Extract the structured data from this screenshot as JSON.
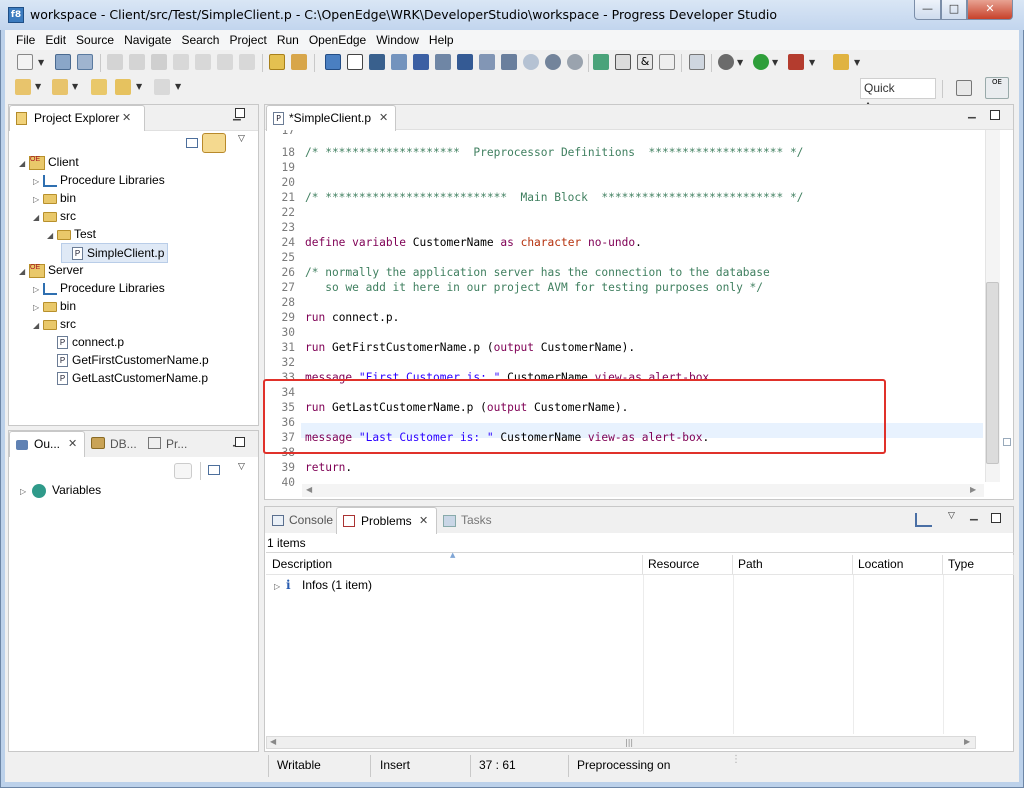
{
  "window": {
    "title": "workspace - Client/src/Test/SimpleClient.p - C:\\OpenEdge\\WRK\\DeveloperStudio\\workspace - Progress Developer Studio",
    "controls": {
      "minimize": "—",
      "maximize": "□",
      "close": "✕"
    }
  },
  "menubar": [
    "File",
    "Edit",
    "Source",
    "Navigate",
    "Search",
    "Project",
    "Run",
    "OpenEdge",
    "Window",
    "Help"
  ],
  "toolbar": {
    "quick_access": "Quick Access"
  },
  "project_explorer": {
    "tab_label": "Project Explorer",
    "tree": [
      {
        "label": "Client",
        "depth": 0,
        "kind": "project",
        "expanded": true
      },
      {
        "label": "Procedure Libraries",
        "depth": 1,
        "kind": "library",
        "expanded": false
      },
      {
        "label": "bin",
        "depth": 1,
        "kind": "folder",
        "expanded": false
      },
      {
        "label": "src",
        "depth": 1,
        "kind": "folder",
        "expanded": true
      },
      {
        "label": "Test",
        "depth": 2,
        "kind": "folder",
        "expanded": true
      },
      {
        "label": "SimpleClient.p",
        "depth": 3,
        "kind": "file",
        "selected": true
      },
      {
        "label": "Server",
        "depth": 0,
        "kind": "project",
        "expanded": true
      },
      {
        "label": "Procedure Libraries",
        "depth": 1,
        "kind": "library",
        "expanded": false
      },
      {
        "label": "bin",
        "depth": 1,
        "kind": "folder",
        "expanded": false
      },
      {
        "label": "src",
        "depth": 1,
        "kind": "folder",
        "expanded": true
      },
      {
        "label": "connect.p",
        "depth": 2,
        "kind": "file"
      },
      {
        "label": "GetFirstCustomerName.p",
        "depth": 2,
        "kind": "file"
      },
      {
        "label": "GetLastCustomerName.p",
        "depth": 2,
        "kind": "file"
      }
    ]
  },
  "outline": {
    "tabs": [
      "Ou...",
      "DB...",
      "Pr..."
    ],
    "tree_item": "Variables"
  },
  "editor": {
    "tab_label": "*SimpleClient.p",
    "lines": [
      {
        "n": "17",
        "tokens": []
      },
      {
        "n": "18",
        "tokens": [
          {
            "c": "cm",
            "t": "/* ********************  Preprocessor Definitions  ******************** */"
          }
        ]
      },
      {
        "n": "19",
        "tokens": []
      },
      {
        "n": "20",
        "tokens": []
      },
      {
        "n": "21",
        "tokens": [
          {
            "c": "cm",
            "t": "/* ***************************  Main Block  *************************** */"
          }
        ]
      },
      {
        "n": "22",
        "tokens": []
      },
      {
        "n": "23",
        "tokens": []
      },
      {
        "n": "24",
        "tokens": [
          {
            "c": "kw",
            "t": "define variable"
          },
          {
            "c": "",
            "t": " CustomerName "
          },
          {
            "c": "kw",
            "t": "as"
          },
          {
            "c": "",
            "t": " "
          },
          {
            "c": "ty",
            "t": "character"
          },
          {
            "c": "",
            "t": " "
          },
          {
            "c": "kw",
            "t": "no-undo"
          },
          {
            "c": "",
            "t": "."
          }
        ]
      },
      {
        "n": "25",
        "tokens": []
      },
      {
        "n": "26",
        "tokens": [
          {
            "c": "cm",
            "t": "/* normally the application server has the connection to the database"
          }
        ]
      },
      {
        "n": "27",
        "tokens": [
          {
            "c": "cm",
            "t": "   so we add it here in our project AVM for testing purposes only */"
          }
        ]
      },
      {
        "n": "28",
        "tokens": []
      },
      {
        "n": "29",
        "tokens": [
          {
            "c": "kw",
            "t": "run"
          },
          {
            "c": "",
            "t": " connect.p."
          }
        ]
      },
      {
        "n": "30",
        "tokens": []
      },
      {
        "n": "31",
        "tokens": [
          {
            "c": "kw",
            "t": "run"
          },
          {
            "c": "",
            "t": " GetFirstCustomerName.p ("
          },
          {
            "c": "kw",
            "t": "output"
          },
          {
            "c": "",
            "t": " CustomerName)."
          }
        ]
      },
      {
        "n": "32",
        "tokens": []
      },
      {
        "n": "33",
        "tokens": [
          {
            "c": "kw",
            "t": "message"
          },
          {
            "c": "",
            "t": " "
          },
          {
            "c": "st",
            "t": "\"First Customer is: \""
          },
          {
            "c": "",
            "t": " CustomerName "
          },
          {
            "c": "kw",
            "t": "view-as alert-box"
          },
          {
            "c": "",
            "t": "."
          }
        ]
      },
      {
        "n": "34",
        "tokens": []
      },
      {
        "n": "35",
        "tokens": [
          {
            "c": "kw",
            "t": "run"
          },
          {
            "c": "",
            "t": " GetLastCustomerName.p ("
          },
          {
            "c": "kw",
            "t": "output"
          },
          {
            "c": "",
            "t": " CustomerName)."
          }
        ]
      },
      {
        "n": "36",
        "tokens": []
      },
      {
        "n": "37",
        "tokens": [
          {
            "c": "kw",
            "t": "message"
          },
          {
            "c": "",
            "t": " "
          },
          {
            "c": "st",
            "t": "\"Last Customer is: \""
          },
          {
            "c": "",
            "t": " CustomerName "
          },
          {
            "c": "kw",
            "t": "view-as alert-box"
          },
          {
            "c": "",
            "t": "."
          }
        ]
      },
      {
        "n": "38",
        "tokens": []
      },
      {
        "n": "39",
        "tokens": [
          {
            "c": "kw",
            "t": "return"
          },
          {
            "c": "",
            "t": "."
          }
        ]
      },
      {
        "n": "40",
        "tokens": []
      }
    ]
  },
  "bottom_panel": {
    "tabs": [
      "Console",
      "Problems",
      "Tasks"
    ],
    "active_tab": "Problems",
    "summary": "1 items",
    "columns": [
      "Description",
      "Resource",
      "Path",
      "Location",
      "Type"
    ],
    "rows": [
      {
        "label": "Infos (1 item)",
        "icon": "i"
      }
    ]
  },
  "statusbar": {
    "mode": "Writable",
    "insert": "Insert",
    "position": "37 : 61",
    "message": "Preprocessing on"
  }
}
